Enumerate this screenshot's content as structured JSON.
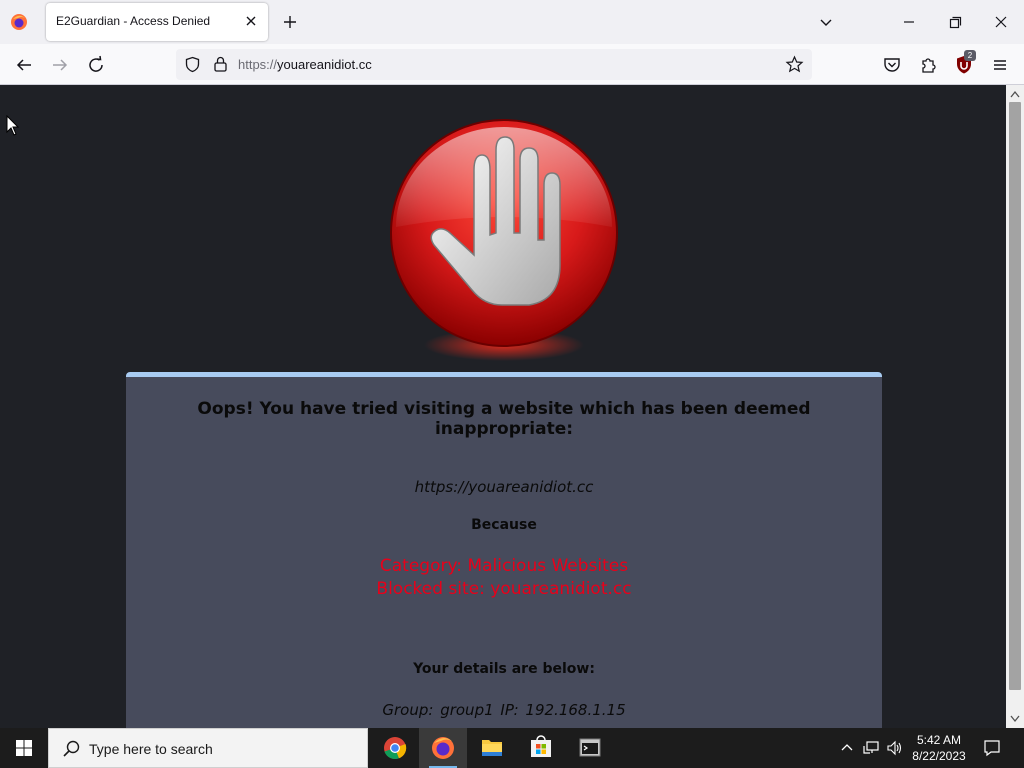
{
  "browser": {
    "tab_title": "E2Guardian - Access Denied",
    "url_scheme": "https://",
    "url_host": "youareanidiot.cc",
    "extension_badge": "2"
  },
  "page": {
    "heading": "Oops! You have tried visiting a website which has been deemed inappropriate:",
    "blocked_url": "https://youareanidiot.cc",
    "because_label": "Because",
    "category_line": "Category: Malicious Websites",
    "blocked_site_line": "Blocked site: youareanidiot.cc",
    "details_title": "Your details are below:",
    "details_line": "Group: group1   IP: 192.168.1.15"
  },
  "taskbar": {
    "search_placeholder": "Type here to search",
    "time": "5:42 AM",
    "date": "8/22/2023"
  },
  "colors": {
    "page_background": "#1f2126",
    "panel_background": "#474b5c",
    "panel_top_border": "#a9ccf2",
    "reason_text": "#e8001a",
    "stop_icon_red": "#d81a1a"
  }
}
